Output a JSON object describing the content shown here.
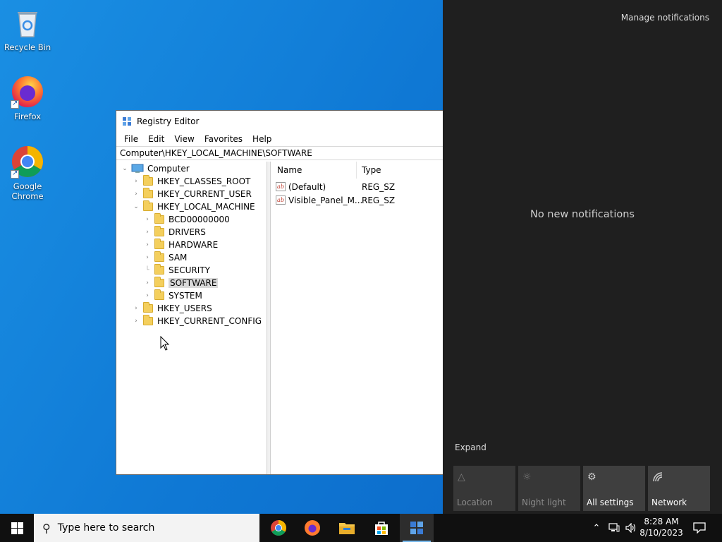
{
  "desktop": {
    "icons": [
      {
        "label": "Recycle Bin"
      },
      {
        "label": "Firefox"
      },
      {
        "label": "Google Chrome"
      }
    ]
  },
  "regedit": {
    "title": "Registry Editor",
    "menu": [
      "File",
      "Edit",
      "View",
      "Favorites",
      "Help"
    ],
    "address": "Computer\\HKEY_LOCAL_MACHINE\\SOFTWARE",
    "tree": {
      "root": "Computer",
      "hives": [
        "HKEY_CLASSES_ROOT",
        "HKEY_CURRENT_USER",
        "HKEY_LOCAL_MACHINE",
        "HKEY_USERS",
        "HKEY_CURRENT_CONFIG"
      ],
      "hklm_children": [
        "BCD00000000",
        "DRIVERS",
        "HARDWARE",
        "SAM",
        "SECURITY",
        "SOFTWARE",
        "SYSTEM"
      ],
      "selected": "SOFTWARE"
    },
    "list": {
      "columns": [
        "Name",
        "Type"
      ],
      "rows": [
        {
          "name": "(Default)",
          "type": "REG_SZ"
        },
        {
          "name": "Visible_Panel_M...",
          "type": "REG_SZ"
        }
      ]
    }
  },
  "action_center": {
    "manage_label": "Manage notifications",
    "empty_label": "No new notifications",
    "expand_label": "Expand",
    "tiles": [
      {
        "label": "Location",
        "icon": "location-icon",
        "enabled": false
      },
      {
        "label": "Night light",
        "icon": "night-light-icon",
        "enabled": false
      },
      {
        "label": "All settings",
        "icon": "gear-icon",
        "enabled": true
      },
      {
        "label": "Network",
        "icon": "network-icon",
        "enabled": true
      }
    ]
  },
  "taskbar": {
    "search_placeholder": "Type here to search",
    "apps": [
      "chrome-icon",
      "firefox-icon",
      "file-explorer-icon",
      "store-icon",
      "regedit-icon"
    ],
    "time": "8:28 AM",
    "date": "8/10/2023"
  },
  "colors": {
    "desktop_bg": "#0f78d4",
    "action_center_bg": "#1f1f1f",
    "taskbar_bg": "#101010",
    "folder": "#f4cf5d"
  }
}
